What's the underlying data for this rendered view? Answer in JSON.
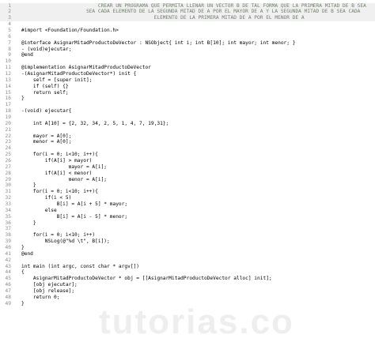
{
  "editor": {
    "lines": [
      {
        "n": "1",
        "t": "                          CREAR UN PROGRAMA QUE PERMITA LLENAR UN VECTOR B DE TAL FORMA QUE LA PRIMERA MITAD DE B SEA"
      },
      {
        "n": "2",
        "t": "                      SEA CADA ELEMENTO DE LA SEGUNDA MITAD DE A POR EL MAYOR DE A Y LA SEGUNDA MITAD DE B SEA CADA"
      },
      {
        "n": "3",
        "t": "                                             ELEMENTO DE LA PRIMERA MITAD DE A POR EL MENOR DE A"
      },
      {
        "n": "4",
        "t": ""
      },
      {
        "n": "5",
        "t": "#import <Foundation/Foundation.h>"
      },
      {
        "n": "6",
        "t": ""
      },
      {
        "n": "7",
        "t": "@interface AsignarMitadProductoDeVector : NSObject{ int i; int B[10]; int mayor; int menor; }"
      },
      {
        "n": "8",
        "t": "- (void)ejecutar;"
      },
      {
        "n": "9",
        "t": "@end"
      },
      {
        "n": "10",
        "t": ""
      },
      {
        "n": "11",
        "t": "@implementation AsignarMitadProductoDeVector"
      },
      {
        "n": "12",
        "t": "-(AsignarMitadProductoDeVector*) init {"
      },
      {
        "n": "13",
        "t": "    self = [super init];"
      },
      {
        "n": "14",
        "t": "    if (self) {}"
      },
      {
        "n": "15",
        "t": "    return self;"
      },
      {
        "n": "16",
        "t": "}"
      },
      {
        "n": "17",
        "t": ""
      },
      {
        "n": "18",
        "t": "-(void) ejecutar{"
      },
      {
        "n": "19",
        "t": ""
      },
      {
        "n": "20",
        "t": "    int A[10] = {2, 32, 34, 2, 5, 1, 4, 7, 19,31};"
      },
      {
        "n": "21",
        "t": ""
      },
      {
        "n": "22",
        "t": "    mayor = A[0];"
      },
      {
        "n": "23",
        "t": "    menor = A[0];"
      },
      {
        "n": "24",
        "t": ""
      },
      {
        "n": "25",
        "t": "    for(i = 0; i<10; i++){"
      },
      {
        "n": "26",
        "t": "        if(A[i] > mayor)"
      },
      {
        "n": "27",
        "t": "                mayor = A[i];"
      },
      {
        "n": "28",
        "t": "        if(A[i] < menor)"
      },
      {
        "n": "29",
        "t": "                menor = A[i];"
      },
      {
        "n": "30",
        "t": "    }"
      },
      {
        "n": "31",
        "t": "    for(i = 0; i<10; i++){"
      },
      {
        "n": "32",
        "t": "        if(i < 5)"
      },
      {
        "n": "33",
        "t": "            B[i] = A[i + 5] * mayor;"
      },
      {
        "n": "34",
        "t": "        else"
      },
      {
        "n": "35",
        "t": "            B[i] = A[i - 5] * menor;"
      },
      {
        "n": "36",
        "t": "    }"
      },
      {
        "n": "37",
        "t": ""
      },
      {
        "n": "38",
        "t": "    for(i = 0; i<10; i++)"
      },
      {
        "n": "39",
        "t": "        NSLog(@\"%d \\t\", B[i]);"
      },
      {
        "n": "40",
        "t": "}"
      },
      {
        "n": "41",
        "t": "@end"
      },
      {
        "n": "42",
        "t": ""
      },
      {
        "n": "43",
        "t": "int main (int argc, const char * argv[])"
      },
      {
        "n": "44",
        "t": "{"
      },
      {
        "n": "45",
        "t": "    AsignarMitadProductoDeVector * obj = [[AsignarMitadProductoDeVector alloc] init];"
      },
      {
        "n": "46",
        "t": "    [obj ejecutar];"
      },
      {
        "n": "47",
        "t": "    [obj release];"
      },
      {
        "n": "48",
        "t": "    return 0;"
      },
      {
        "n": "49",
        "t": "}"
      }
    ]
  },
  "watermark": "tutorias.co",
  "colors": {
    "keyword": "#0000a0",
    "comment": "#6f7f6a",
    "gutter": "#8a8a8a",
    "background": "#ffffff"
  }
}
